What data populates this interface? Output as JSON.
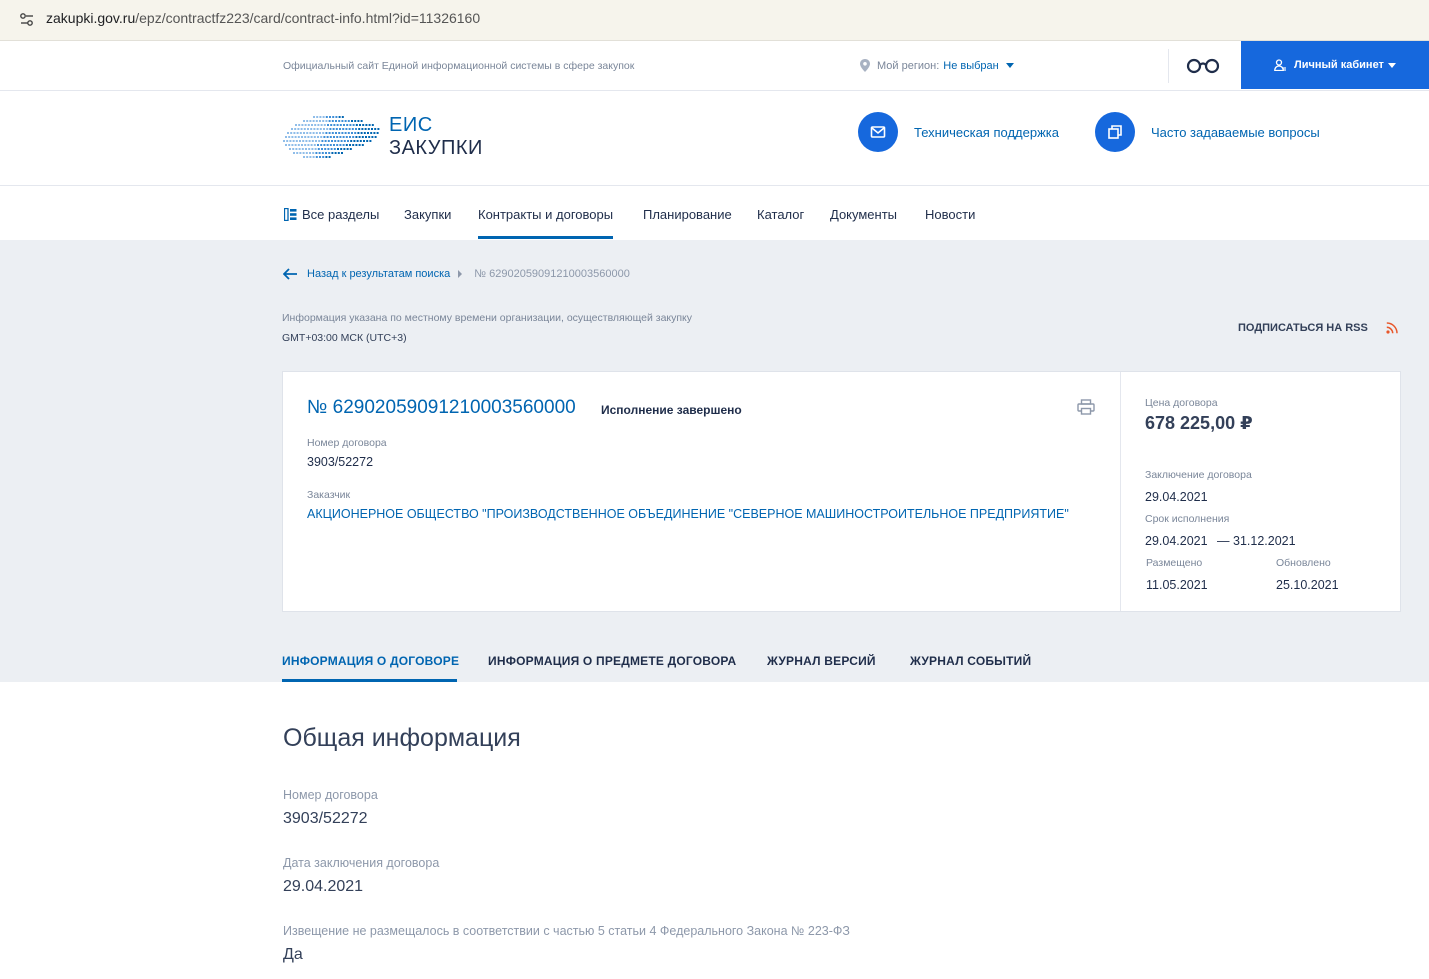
{
  "browser": {
    "url_host": "zakupki.gov.ru",
    "url_path": "/epz/contractfz223/card/contract-info.html?id=11326160"
  },
  "header": {
    "official_text": "Официальный сайт Единой информационной системы в сфере закупок",
    "region_label": "Мой регион:",
    "region_value": "Не выбран",
    "cabinet_label": "Личный кабинет"
  },
  "logo": {
    "line1": "ЕИС",
    "line2": "ЗАКУПКИ"
  },
  "links": {
    "support": "Техническая поддержка",
    "faq": "Часто задаваемые вопросы"
  },
  "nav": {
    "items": [
      "Все разделы",
      "Закупки",
      "Контракты и договоры",
      "Планирование",
      "Каталог",
      "Документы",
      "Новости"
    ],
    "active": "Контракты и договоры"
  },
  "breadcrumb": {
    "back": "Назад к результатам поиска",
    "current": "№ 62902059091210003560000"
  },
  "timezone": {
    "note": "Информация указана по местному времени организации, осуществляющей закупку",
    "value": "GMT+03:00 МСК (UTC+3)"
  },
  "rss_label": "ПОДПИСАТЬСЯ НА RSS",
  "card": {
    "reg_number": "№ 62902059091210003560000",
    "status": "Исполнение завершено",
    "contract_number_label": "Номер договора",
    "contract_number": "3903/52272",
    "customer_label": "Заказчик",
    "customer": "АКЦИОНЕРНОЕ ОБЩЕСТВО \"ПРОИЗВОДСТВЕННОЕ ОБЪЕДИНЕНИЕ \"СЕВЕРНОЕ МАШИНОСТРОИТЕЛЬНОЕ ПРЕДПРИЯТИЕ\"",
    "price_label": "Цена договора",
    "price": "678 225,00 ₽",
    "conclusion_label": "Заключение договора",
    "conclusion_date": "29.04.2021",
    "term_label": "Срок исполнения",
    "term_start": "29.04.2021",
    "term_dash": "—",
    "term_end": "31.12.2021",
    "placed_label": "Размещено",
    "placed_date": "11.05.2021",
    "updated_label": "Обновлено",
    "updated_date": "25.10.2021"
  },
  "tabs": [
    "ИНФОРМАЦИЯ О ДОГОВОРЕ",
    "ИНФОРМАЦИЯ О ПРЕДМЕТЕ ДОГОВОРА",
    "ЖУРНАЛ ВЕРСИЙ",
    "ЖУРНАЛ СОБЫТИЙ"
  ],
  "general": {
    "title": "Общая информация",
    "fields": [
      {
        "label": "Номер договора",
        "value": "3903/52272"
      },
      {
        "label": "Дата заключения договора",
        "value": "29.04.2021"
      },
      {
        "label": "Извещение не размещалось в соответствии с частью 5 статьи 4 Федерального Закона № 223-ФЗ",
        "value": "Да"
      }
    ]
  },
  "colors": {
    "accent": "#0065b1",
    "button": "#1668dd",
    "band": "#eceff3",
    "rss": "#e8572a"
  }
}
